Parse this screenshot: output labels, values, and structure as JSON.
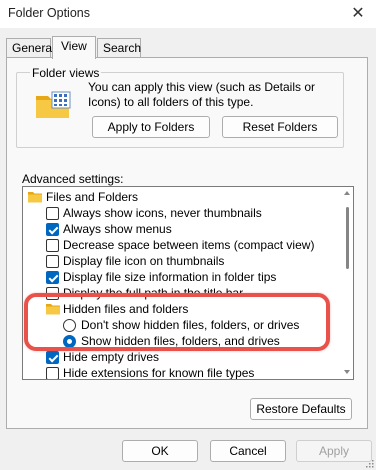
{
  "window": {
    "title": "Folder Options",
    "close_glyph": "✕"
  },
  "tabs": [
    {
      "label": "General",
      "active": false
    },
    {
      "label": "View",
      "active": true
    },
    {
      "label": "Search",
      "active": false
    }
  ],
  "folder_views": {
    "group_label": "Folder views",
    "description": "You can apply this view (such as Details or Icons) to all folders of this type.",
    "icon": "folder-grid-icon",
    "apply_button": "Apply to Folders",
    "reset_button": "Reset Folders"
  },
  "advanced": {
    "label": "Advanced settings:",
    "items": [
      {
        "kind": "folder",
        "text": "Files and Folders"
      },
      {
        "kind": "checkbox",
        "checked": false,
        "text": "Always show icons, never thumbnails"
      },
      {
        "kind": "checkbox",
        "checked": true,
        "text": "Always show menus"
      },
      {
        "kind": "checkbox",
        "checked": false,
        "text": "Decrease space between items (compact view)"
      },
      {
        "kind": "checkbox",
        "checked": false,
        "text": "Display file icon on thumbnails"
      },
      {
        "kind": "checkbox",
        "checked": true,
        "text": "Display file size information in folder tips"
      },
      {
        "kind": "checkbox",
        "checked": false,
        "text": "Display the full path in the title bar"
      },
      {
        "kind": "folder",
        "text": "Hidden files and folders"
      },
      {
        "kind": "radio",
        "checked": false,
        "text": "Don't show hidden files, folders, or drives"
      },
      {
        "kind": "radio",
        "checked": true,
        "text": "Show hidden files, folders, and drives"
      },
      {
        "kind": "checkbox",
        "checked": true,
        "text": "Hide empty drives"
      },
      {
        "kind": "checkbox",
        "checked": false,
        "text": "Hide extensions for known file types"
      }
    ],
    "restore_button": "Restore Defaults"
  },
  "footer": {
    "ok": "OK",
    "cancel": "Cancel",
    "apply": "Apply"
  },
  "colors": {
    "accent": "#0067c0",
    "highlight": "#e8524a",
    "folder": "#f6c844"
  }
}
